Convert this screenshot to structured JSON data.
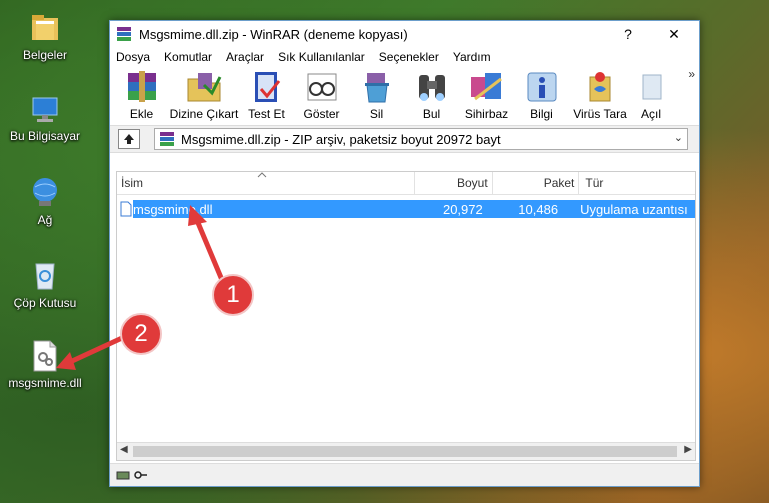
{
  "desktop": {
    "icons": [
      {
        "label": "Belgeler"
      },
      {
        "label": "Bu Bilgisayar"
      },
      {
        "label": "Ağ"
      },
      {
        "label": "Çöp Kutusu"
      },
      {
        "label": "msgsmime.dll"
      }
    ],
    "badges": [
      "1",
      "2"
    ]
  },
  "window": {
    "title": "Msgsmime.dll.zip - WinRAR (deneme kopyası)",
    "help": "?",
    "minimize": "–",
    "close": "✕"
  },
  "menu": [
    "Dosya",
    "Komutlar",
    "Araçlar",
    "Sık Kullanılanlar",
    "Seçenekler",
    "Yardım"
  ],
  "toolbar": [
    {
      "label": "Ekle",
      "icon": "add-icon"
    },
    {
      "label": "Dizine Çıkart",
      "icon": "extract-icon"
    },
    {
      "label": "Test Et",
      "icon": "test-icon"
    },
    {
      "label": "Göster",
      "icon": "view-icon"
    },
    {
      "label": "Sil",
      "icon": "delete-icon"
    },
    {
      "label": "Bul",
      "icon": "find-icon"
    },
    {
      "label": "Sihirbaz",
      "icon": "wizard-icon"
    },
    {
      "label": "Bilgi",
      "icon": "info-icon"
    },
    {
      "label": "Virüs Tara",
      "icon": "virus-scan-icon"
    },
    {
      "label": "Açıl",
      "icon": "comment-icon"
    }
  ],
  "toolbar_more": "»",
  "address": {
    "text": "Msgsmime.dll.zip - ZIP arşiv, paketsiz boyut 20972 bayt",
    "dropdown": "⌄"
  },
  "columns": {
    "name": "İsim",
    "size": "Boyut",
    "packed": "Paket",
    "type": "Tür"
  },
  "files": [
    {
      "name": "msgsmime.dll",
      "size": "20,972",
      "packed": "10,486",
      "type": "Uygulama uzantısı"
    }
  ],
  "colors": {
    "selection": "#3399ff",
    "badge": "#e03a3a"
  }
}
